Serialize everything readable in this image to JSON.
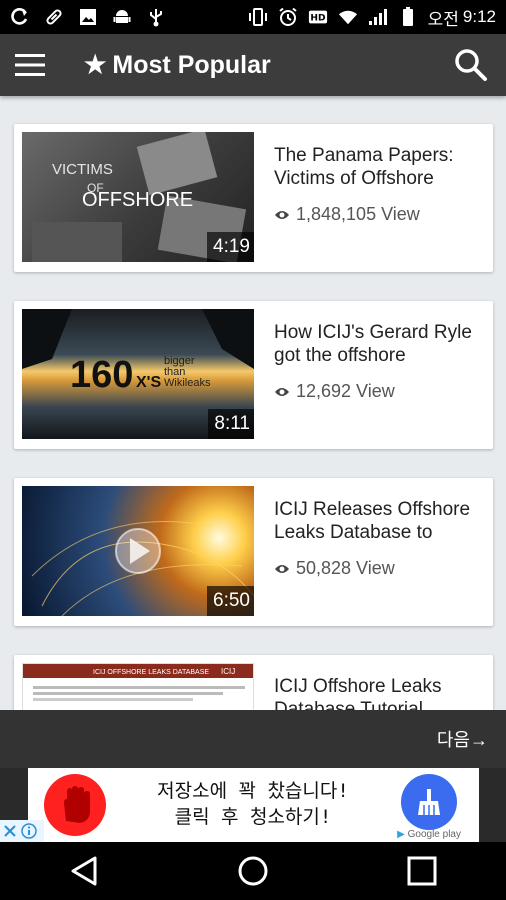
{
  "status_bar": {
    "carrier": "오전",
    "time": "9:12",
    "left_icons": [
      "sync-icon",
      "pill-icon",
      "image-icon",
      "android-icon",
      "usb-icon"
    ],
    "right_icons": [
      "vibrate-icon",
      "alarm-icon",
      "hd-icon",
      "wifi-icon",
      "signal-icon",
      "battery-icon"
    ]
  },
  "app_bar": {
    "title": "Most Popular",
    "star": "★"
  },
  "videos": [
    {
      "title": "The Panama Papers: Victims of Offshore",
      "views": "1,848,105 View",
      "duration": "4:19",
      "thumb_text": [
        "VICTIMS",
        "OF",
        "OFFSHORE"
      ]
    },
    {
      "title": "How ICIJ's Gerard Ryle got the offshore",
      "views": "12,692 View",
      "duration": "8:11",
      "thumb_text": [
        "160",
        "X'S",
        "bigger",
        "than",
        "Wikileaks"
      ]
    },
    {
      "title": "ICIJ Releases Offshore Leaks Database to",
      "views": "50,828 View",
      "duration": "6:50"
    },
    {
      "title": "ICIJ Offshore Leaks Database Tutorial",
      "thumb_text": [
        "ICIJ OFFSHORE LEAKS DATABASE",
        "ICIJ"
      ]
    }
  ],
  "next_button": "다음→",
  "ad": {
    "line1": "저장소에 꽉 찼습니다!",
    "line2": "클릭 후 청소하기!",
    "store": "Google play"
  },
  "colors": {
    "app_bar": "#3c3c3c",
    "list_bg": "#e8ebee",
    "ad_red": "#ff2020",
    "ad_blue": "#3b6cf0"
  }
}
